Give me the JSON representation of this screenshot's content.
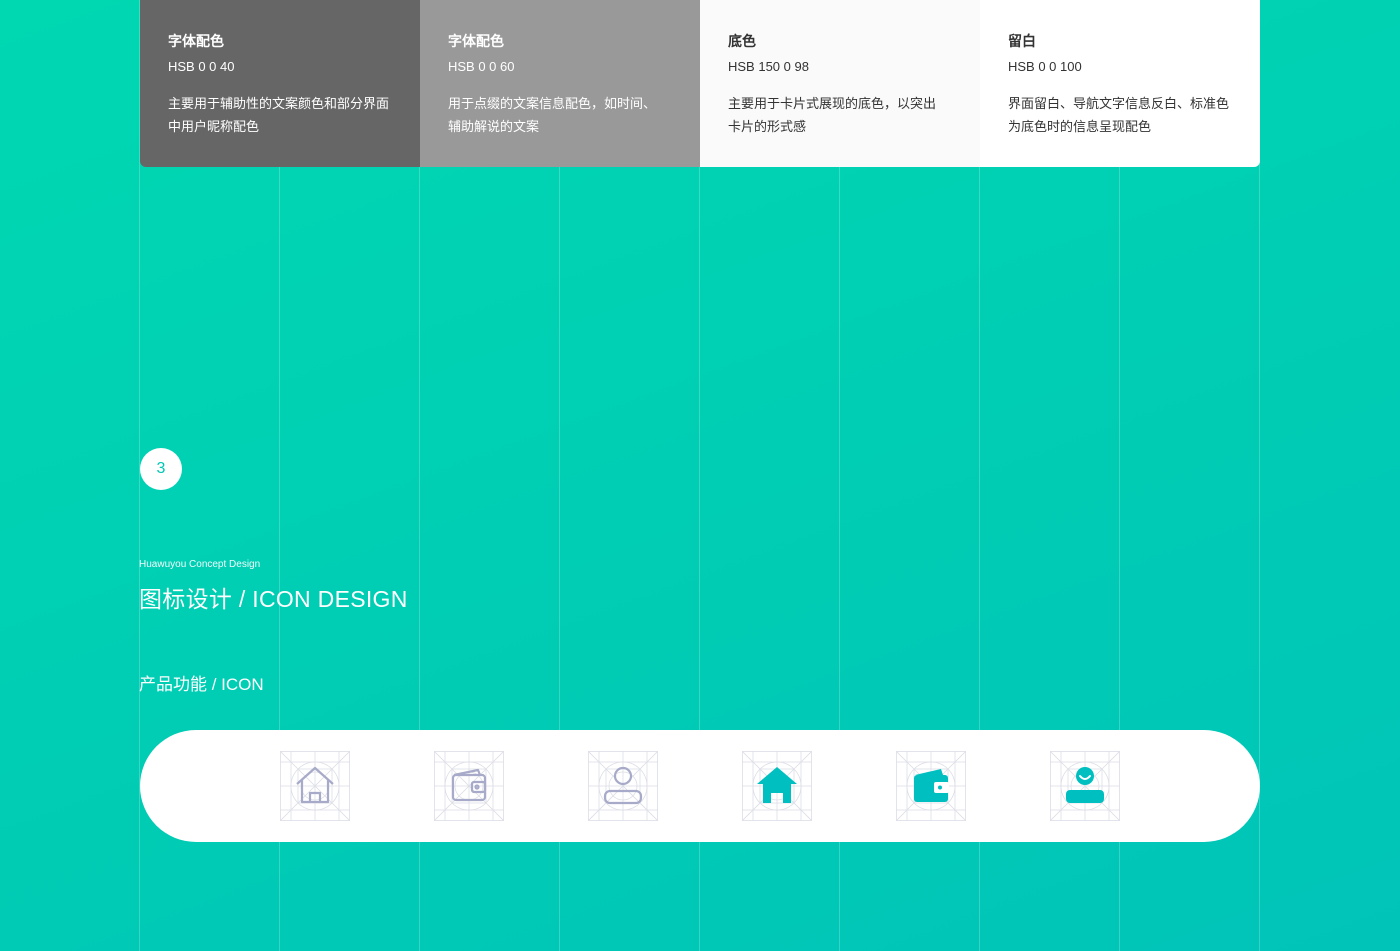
{
  "swatches": [
    {
      "name": "字体配色",
      "hsb": "HSB  0 0 40",
      "desc_line1": "主要用于辅助性的文案颜色和部分界面",
      "desc_line2": "中用户昵称配色",
      "bg": "#666666",
      "fg": "#ffffff"
    },
    {
      "name": "字体配色",
      "hsb": "HSB  0 0 60",
      "desc_line1": "用于点缀的文案信息配色，如时间、",
      "desc_line2": "辅助解说的文案",
      "bg": "#999999",
      "fg": "#ffffff"
    },
    {
      "name": "底色",
      "hsb": "HSB  150 0 98",
      "desc_line1": "主要用于卡片式展现的底色，以突出",
      "desc_line2": "卡片的形式感",
      "bg": "#fafafa",
      "fg": "#333333"
    },
    {
      "name": "留白",
      "hsb": "HSB  0 0 100",
      "desc_line1": "界面留白、导航文字信息反白、标准色",
      "desc_line2": "为底色时的信息呈现配色",
      "bg": "#ffffff",
      "fg": "#333333"
    }
  ],
  "section": {
    "number": "3",
    "eyebrow": "Huawuyou Concept Design",
    "title": "图标设计 / ICON DESIGN",
    "subtitle": "产品功能 / ICON"
  },
  "icons": [
    {
      "name": "home-outline-icon",
      "style": "outline"
    },
    {
      "name": "wallet-outline-icon",
      "style": "outline"
    },
    {
      "name": "user-outline-icon",
      "style": "outline"
    },
    {
      "name": "home-filled-icon",
      "style": "filled"
    },
    {
      "name": "wallet-filled-icon",
      "style": "filled"
    },
    {
      "name": "user-filled-icon",
      "style": "filled"
    }
  ],
  "colors": {
    "background": "#00d0b4",
    "accent": "#00bfc0",
    "outline_icon": "#a7aac8",
    "construction_grid": "#d9dbe3"
  }
}
